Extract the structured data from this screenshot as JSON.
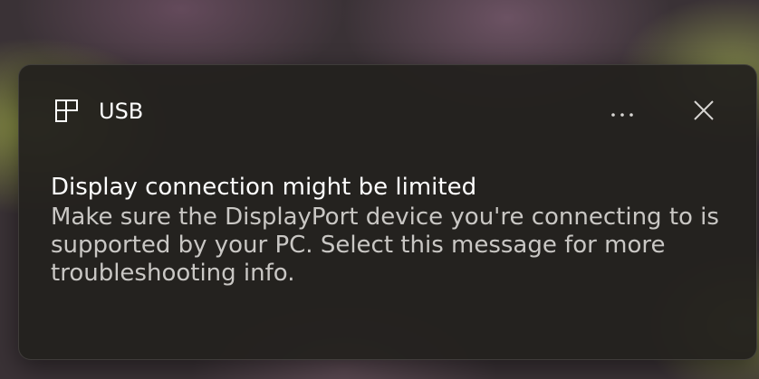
{
  "notification": {
    "app_name": "USB",
    "app_icon": "usb-device-icon",
    "title": "Display connection might be limited",
    "message": "Make sure the DisplayPort device you're connecting to is supported by your PC. Select this message for more troubleshooting info.",
    "actions": {
      "more_icon": "ellipsis-icon",
      "close_icon": "close-icon"
    }
  },
  "colors": {
    "toast_background": "#23211e",
    "title_text": "#ffffff",
    "message_text": "#c9c7c4"
  }
}
